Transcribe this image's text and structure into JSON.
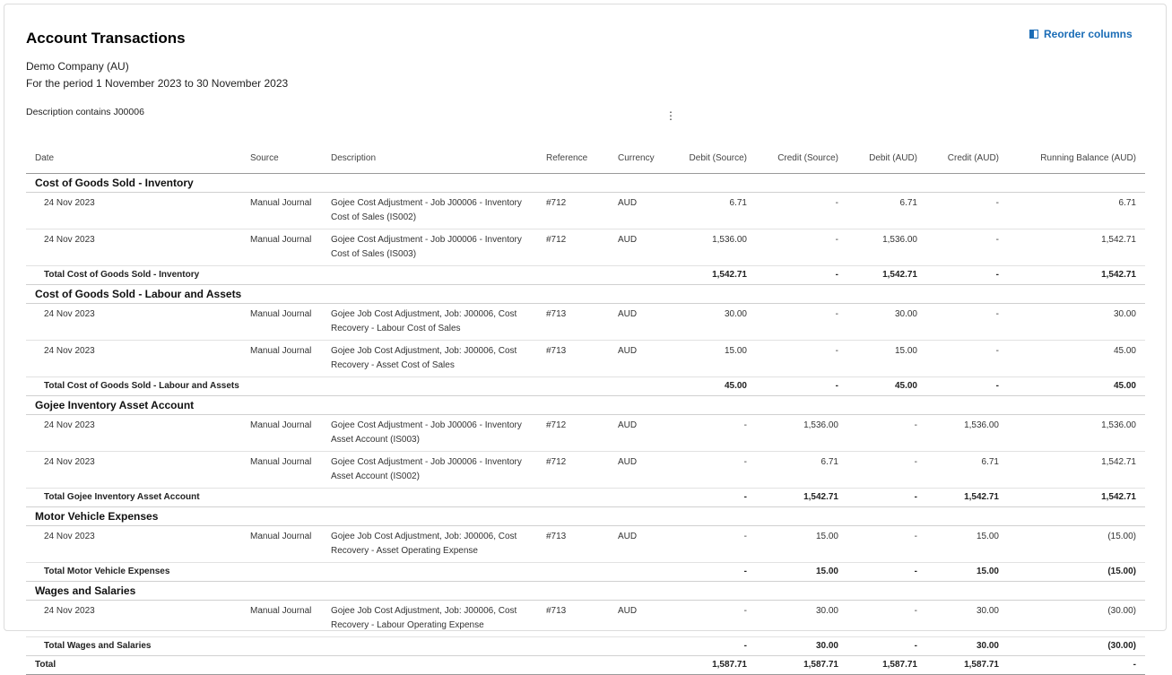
{
  "header": {
    "title": "Account Transactions",
    "company": "Demo Company (AU)",
    "period": "For the period 1 November 2023 to 30 November 2023",
    "filter": "Description contains J00006",
    "reorder_label": "Reorder columns",
    "kebab_glyph": "⋮"
  },
  "columns": {
    "date": "Date",
    "source": "Source",
    "description": "Description",
    "reference": "Reference",
    "currency": "Currency",
    "debit_source": "Debit (Source)",
    "credit_source": "Credit (Source)",
    "debit_aud": "Debit (AUD)",
    "credit_aud": "Credit (AUD)",
    "running_balance": "Running Balance (AUD)"
  },
  "accounts": [
    {
      "name": "Cost of Goods Sold - Inventory",
      "rows": [
        {
          "date": "24 Nov 2023",
          "source": "Manual Journal",
          "description": "Gojee Cost Adjustment - Job J00006 - Inventory Cost of Sales (IS002)",
          "reference": "#712",
          "currency": "AUD",
          "debit_source": "6.71",
          "credit_source": "-",
          "debit_aud": "6.71",
          "credit_aud": "-",
          "balance": "6.71"
        },
        {
          "date": "24 Nov 2023",
          "source": "Manual Journal",
          "description": "Gojee Cost Adjustment - Job J00006 - Inventory Cost of Sales (IS003)",
          "reference": "#712",
          "currency": "AUD",
          "debit_source": "1,536.00",
          "credit_source": "-",
          "debit_aud": "1,536.00",
          "credit_aud": "-",
          "balance": "1,542.71"
        }
      ],
      "total": {
        "label": "Total Cost of Goods Sold - Inventory",
        "debit_source": "1,542.71",
        "credit_source": "-",
        "debit_aud": "1,542.71",
        "credit_aud": "-",
        "balance": "1,542.71"
      }
    },
    {
      "name": "Cost of Goods Sold - Labour and Assets",
      "rows": [
        {
          "date": "24 Nov 2023",
          "source": "Manual Journal",
          "description": "Gojee Job Cost Adjustment, Job: J00006, Cost Recovery - Labour Cost of Sales",
          "reference": "#713",
          "currency": "AUD",
          "debit_source": "30.00",
          "credit_source": "-",
          "debit_aud": "30.00",
          "credit_aud": "-",
          "balance": "30.00"
        },
        {
          "date": "24 Nov 2023",
          "source": "Manual Journal",
          "description": "Gojee Job Cost Adjustment, Job: J00006, Cost Recovery - Asset Cost of Sales",
          "reference": "#713",
          "currency": "AUD",
          "debit_source": "15.00",
          "credit_source": "-",
          "debit_aud": "15.00",
          "credit_aud": "-",
          "balance": "45.00"
        }
      ],
      "total": {
        "label": "Total Cost of Goods Sold - Labour and Assets",
        "debit_source": "45.00",
        "credit_source": "-",
        "debit_aud": "45.00",
        "credit_aud": "-",
        "balance": "45.00"
      }
    },
    {
      "name": "Gojee Inventory Asset Account",
      "rows": [
        {
          "date": "24 Nov 2023",
          "source": "Manual Journal",
          "description": "Gojee Cost Adjustment - Job J00006 - Inventory Asset Account (IS003)",
          "reference": "#712",
          "currency": "AUD",
          "debit_source": "-",
          "credit_source": "1,536.00",
          "debit_aud": "-",
          "credit_aud": "1,536.00",
          "balance": "1,536.00"
        },
        {
          "date": "24 Nov 2023",
          "source": "Manual Journal",
          "description": "Gojee Cost Adjustment - Job J00006 - Inventory Asset Account (IS002)",
          "reference": "#712",
          "currency": "AUD",
          "debit_source": "-",
          "credit_source": "6.71",
          "debit_aud": "-",
          "credit_aud": "6.71",
          "balance": "1,542.71"
        }
      ],
      "total": {
        "label": "Total Gojee Inventory Asset Account",
        "debit_source": "-",
        "credit_source": "1,542.71",
        "debit_aud": "-",
        "credit_aud": "1,542.71",
        "balance": "1,542.71"
      }
    },
    {
      "name": "Motor Vehicle Expenses",
      "rows": [
        {
          "date": "24 Nov 2023",
          "source": "Manual Journal",
          "description": "Gojee Job Cost Adjustment, Job: J00006, Cost Recovery - Asset Operating Expense",
          "reference": "#713",
          "currency": "AUD",
          "debit_source": "-",
          "credit_source": "15.00",
          "debit_aud": "-",
          "credit_aud": "15.00",
          "balance": "(15.00)"
        }
      ],
      "total": {
        "label": "Total Motor Vehicle Expenses",
        "debit_source": "-",
        "credit_source": "15.00",
        "debit_aud": "-",
        "credit_aud": "15.00",
        "balance": "(15.00)"
      }
    },
    {
      "name": "Wages and Salaries",
      "rows": [
        {
          "date": "24 Nov 2023",
          "source": "Manual Journal",
          "description": "Gojee Job Cost Adjustment, Job: J00006, Cost Recovery - Labour Operating Expense",
          "reference": "#713",
          "currency": "AUD",
          "debit_source": "-",
          "credit_source": "30.00",
          "debit_aud": "-",
          "credit_aud": "30.00",
          "balance": "(30.00)"
        }
      ],
      "total": {
        "label": "Total Wages and Salaries",
        "debit_source": "-",
        "credit_source": "30.00",
        "debit_aud": "-",
        "credit_aud": "30.00",
        "balance": "(30.00)"
      }
    }
  ],
  "grand_total": {
    "label": "Total",
    "debit_source": "1,587.71",
    "credit_source": "1,587.71",
    "debit_aud": "1,587.71",
    "credit_aud": "1,587.71",
    "balance": "-"
  }
}
